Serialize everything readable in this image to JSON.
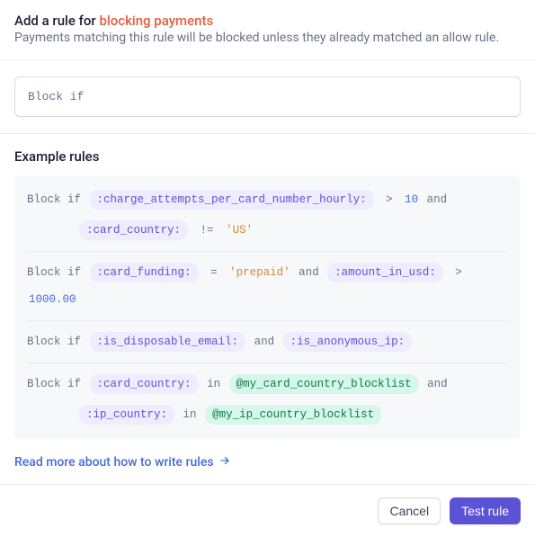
{
  "header": {
    "title_prefix": "Add a rule for ",
    "title_highlight": "blocking payments",
    "subtitle": "Payments matching this rule will be blocked unless they already matched an allow rule."
  },
  "rule_input": {
    "value": "Block if"
  },
  "examples": {
    "heading": "Example rules",
    "rules": [
      {
        "lines": [
          [
            {
              "t": "kw",
              "v": "Block if"
            },
            {
              "t": "field",
              "v": ":charge_attempts_per_card_number_hourly:"
            },
            {
              "t": "op",
              "v": ">"
            },
            {
              "t": "num",
              "v": "10"
            },
            {
              "t": "kw",
              "v": "and"
            }
          ],
          [
            {
              "t": "indent"
            },
            {
              "t": "field",
              "v": ":card_country:"
            },
            {
              "t": "op",
              "v": "!="
            },
            {
              "t": "str",
              "v": "'US'"
            }
          ]
        ]
      },
      {
        "lines": [
          [
            {
              "t": "kw",
              "v": "Block if"
            },
            {
              "t": "field",
              "v": ":card_funding:"
            },
            {
              "t": "op",
              "v": "="
            },
            {
              "t": "str",
              "v": "'prepaid'"
            },
            {
              "t": "kw",
              "v": "and"
            },
            {
              "t": "field",
              "v": ":amount_in_usd:"
            },
            {
              "t": "op",
              "v": ">"
            },
            {
              "t": "num",
              "v": "1000.00"
            }
          ]
        ]
      },
      {
        "lines": [
          [
            {
              "t": "kw",
              "v": "Block if"
            },
            {
              "t": "field",
              "v": ":is_disposable_email:"
            },
            {
              "t": "kw",
              "v": "and"
            },
            {
              "t": "field",
              "v": ":is_anonymous_ip:"
            }
          ]
        ]
      },
      {
        "lines": [
          [
            {
              "t": "kw",
              "v": "Block if"
            },
            {
              "t": "field",
              "v": ":card_country:"
            },
            {
              "t": "kw",
              "v": "in"
            },
            {
              "t": "ref",
              "v": "@my_card_country_blocklist"
            },
            {
              "t": "kw",
              "v": "and"
            }
          ],
          [
            {
              "t": "indent"
            },
            {
              "t": "field",
              "v": ":ip_country:"
            },
            {
              "t": "kw",
              "v": "in"
            },
            {
              "t": "ref",
              "v": "@my_ip_country_blocklist"
            }
          ]
        ]
      }
    ]
  },
  "docs_link": {
    "label": "Read more about how to write rules"
  },
  "footer": {
    "cancel_label": "Cancel",
    "primary_label": "Test rule"
  }
}
